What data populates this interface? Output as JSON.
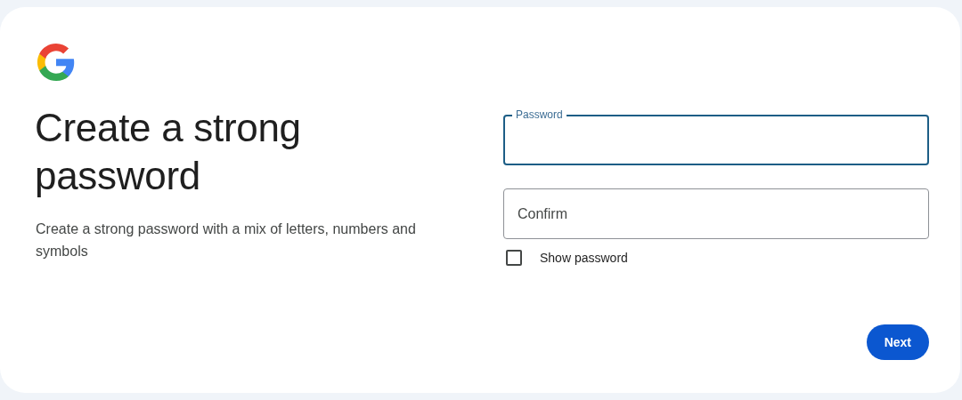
{
  "heading": "Create a strong password",
  "description": "Create a strong password with a mix of letters, numbers and symbols",
  "fields": [
    {
      "kind": "floating",
      "label": "Password",
      "focused": true
    },
    {
      "kind": "placeholder",
      "placeholder": "Confirm",
      "focused": false
    }
  ],
  "show_password": {
    "label": "Show password",
    "checked": false
  },
  "buttons": [
    {
      "label": "Next"
    }
  ]
}
